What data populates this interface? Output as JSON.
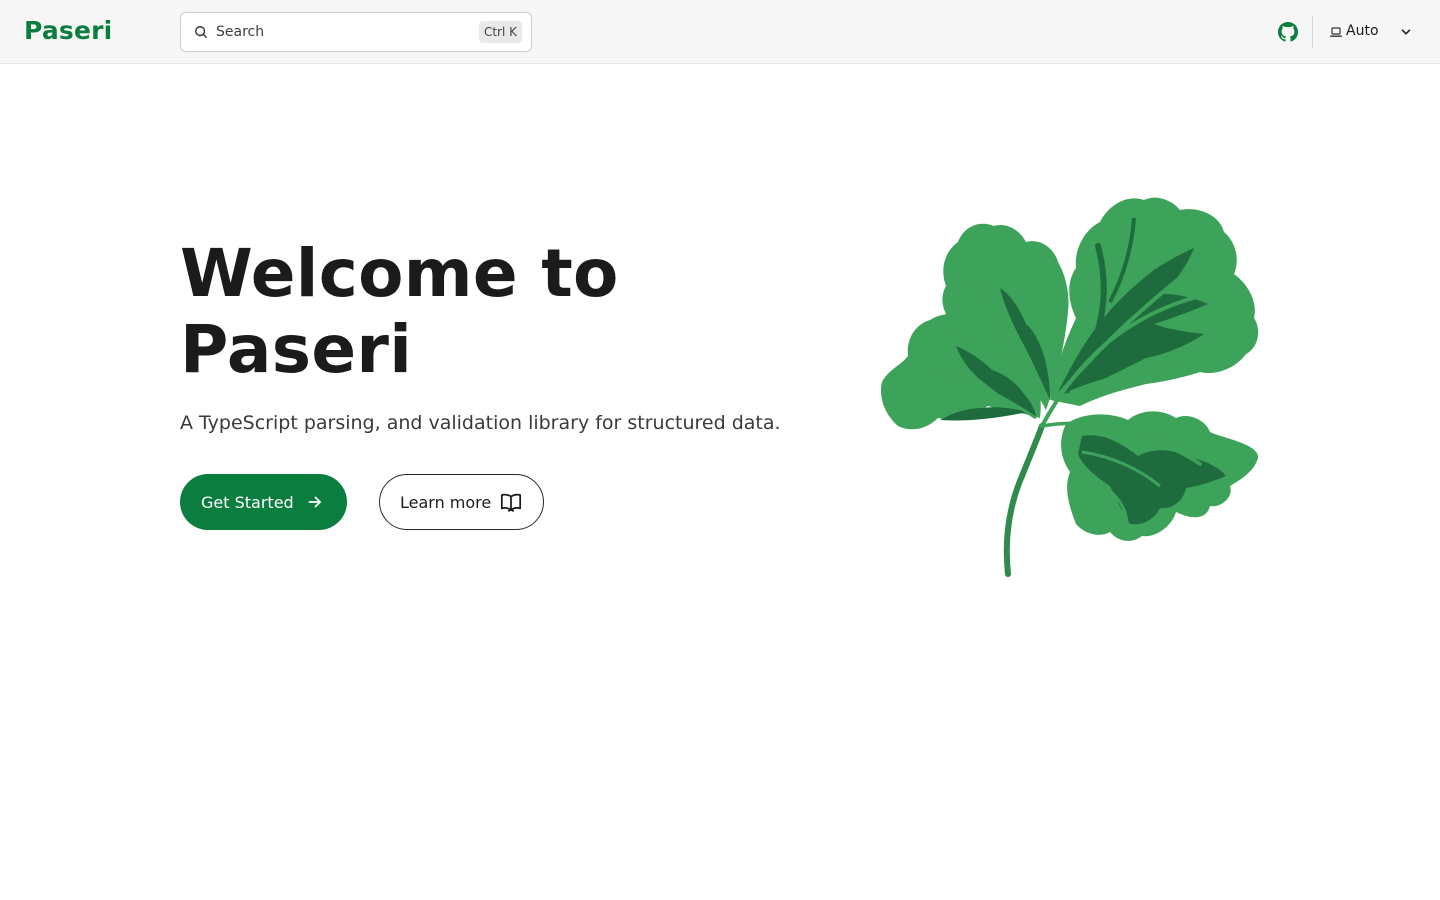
{
  "header": {
    "brand": "Paseri",
    "search": {
      "placeholder": "Search",
      "shortcut": "Ctrl K"
    },
    "github_icon": "github-icon",
    "theme": {
      "icon": "laptop-icon",
      "selected": "Auto"
    }
  },
  "hero": {
    "title": "Welcome to Paseri",
    "subtitle": "A TypeScript parsing, and validation library for structured data.",
    "primary_button": {
      "label": "Get Started",
      "icon": "arrow-right-icon"
    },
    "secondary_button": {
      "label": "Learn more",
      "icon": "book-open-icon"
    },
    "illustration": "parsley-leaf-illustration"
  },
  "colors": {
    "brand": "#0b7d3e",
    "header_bg": "#f6f6f6",
    "leaf_light": "#3ea35a",
    "leaf_dark": "#1e6b3e"
  }
}
